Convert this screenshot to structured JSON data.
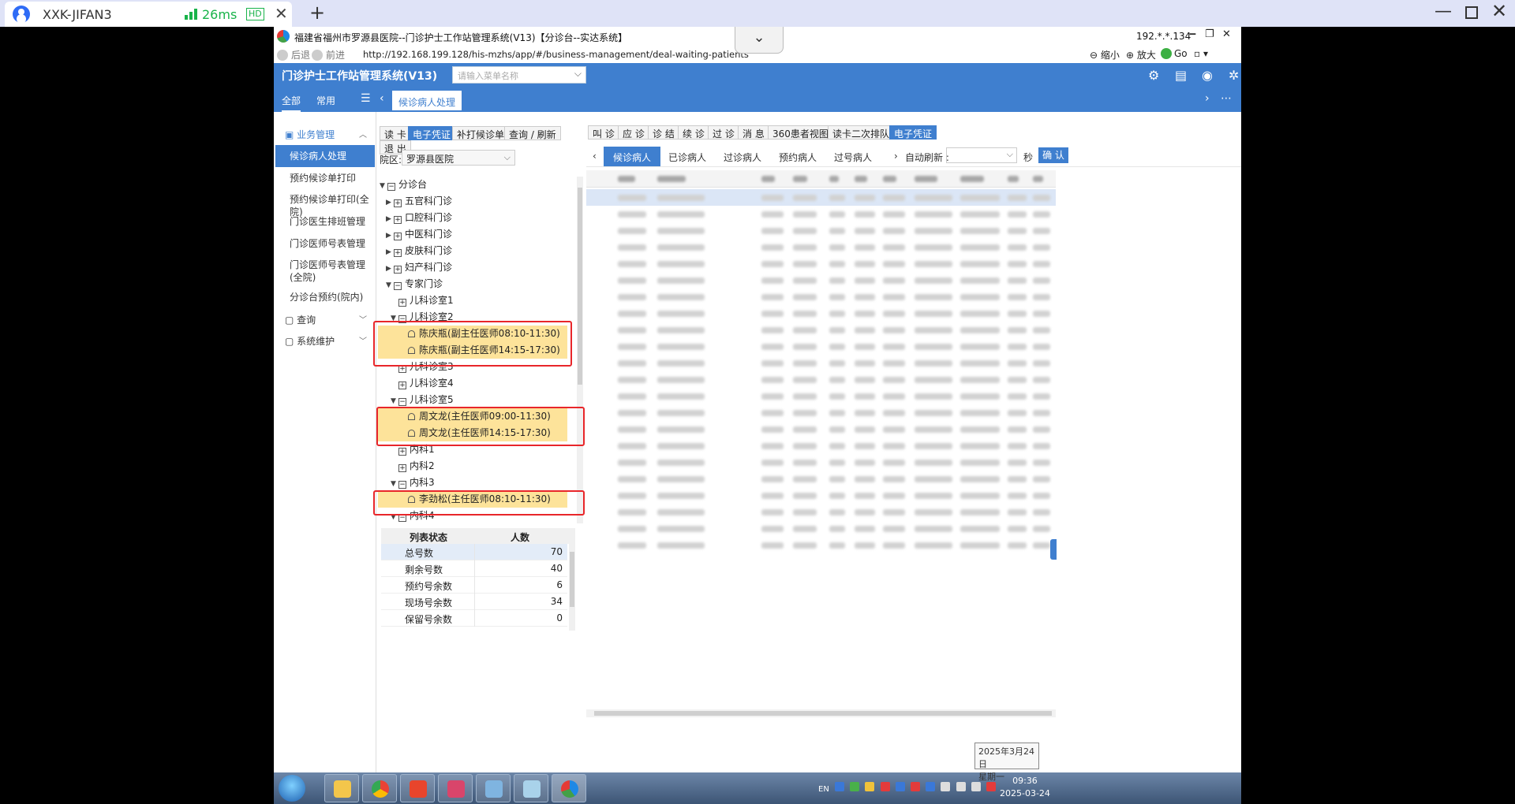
{
  "client": {
    "tab_title": "XXK-JIFAN3",
    "ping": "26ms",
    "hd": "HD",
    "close": "✕",
    "new_tab": "+",
    "minimize": "—",
    "close_window": "✕",
    "colors": {
      "accent": "#2f6cf6",
      "good": "#19b34a"
    }
  },
  "browser": {
    "title": "福建省福州市罗源县医院--门诊护士工作站管理系统(V13)【分诊台--实达系统】",
    "ip": "192.*.*.134",
    "win_min": "‒",
    "win_restore": "❐",
    "win_close": "✕",
    "back": "后退",
    "forward": "前进",
    "url": "http://192.168.199.128/his-mzhs/app/#/business-management/deal-waiting-patients",
    "zoom_out": "缩小",
    "zoom_in": "放大",
    "go": "Go",
    "drop_icon": "chevron-down-icon"
  },
  "app": {
    "system_name": "门诊护士工作站管理系统(V13)",
    "menu_search_placeholder": "请输入菜单名称",
    "tabs": [
      "全部",
      "常用"
    ],
    "open_tab": "候诊病人处理",
    "accent": "#3f7fcf"
  },
  "left_menu": {
    "group_business": "业务管理",
    "items": [
      "候诊病人处理",
      "预约候诊单打印",
      "预约候诊单打印(全院)",
      "门诊医生排班管理",
      "门诊医师号表管理",
      "门诊医师号表管理(全院)",
      "分诊台预约(院内)"
    ],
    "group_query": "查询",
    "group_system": "系统维护"
  },
  "mid": {
    "buttons": [
      "读 卡",
      "电子凭证",
      "补打候诊单",
      "查询 / 刷新"
    ],
    "exit": "退 出",
    "campus_label": "院区:",
    "campus_value": "罗源县医院",
    "tree": {
      "root": "分诊台",
      "depts": [
        "五官科门诊",
        "口腔科门诊",
        "中医科门诊",
        "皮肤科门诊",
        "妇产科门诊"
      ],
      "expert": "专家门诊",
      "room1": "儿科诊室1",
      "room2": "儿科诊室2",
      "doc_chen_am": "陈庆瓶(副主任医师08:10-11:30)",
      "doc_chen_pm": "陈庆瓶(副主任医师14:15-17:30)",
      "room3": "儿科诊室3",
      "room4": "儿科诊室4",
      "room5": "儿科诊室5",
      "doc_zhou_am": "周文龙(主任医师09:00-11:30)",
      "doc_zhou_pm": "周文龙(主任医师14:15-17:30)",
      "nk1": "内科1",
      "nk2": "内科2",
      "nk3": "内科3",
      "doc_li": "李劲松(主任医师08:10-11:30)",
      "nk4": "内科4"
    },
    "stats": {
      "col_status": "列表状态",
      "col_count": "人数",
      "rows": [
        {
          "k": "总号数",
          "v": "70"
        },
        {
          "k": "剩余号数",
          "v": "40"
        },
        {
          "k": "预约号余数",
          "v": "6"
        },
        {
          "k": "现场号余数",
          "v": "34"
        },
        {
          "k": "保留号余数",
          "v": "0"
        }
      ]
    },
    "highlight_color": "#e8262a",
    "doctor_bg": "#fde39a"
  },
  "right": {
    "buttons": [
      "叫 诊",
      "应 诊",
      "诊 结",
      "续 诊",
      "过 诊",
      "消 息",
      "360患者视图",
      "读卡二次排队",
      "电子凭证"
    ],
    "patient_tabs": [
      "候诊病人",
      "已诊病人",
      "过诊病人",
      "预约病人",
      "过号病人"
    ],
    "auto_refresh": "自动刷新 :",
    "seconds": "秒",
    "confirm": "确 认"
  },
  "datebox": {
    "date": "2025年3月24日",
    "weekday": "星期一"
  },
  "taskbar": {
    "ime": "EN",
    "time": "09:36",
    "date": "2025-03-24"
  }
}
